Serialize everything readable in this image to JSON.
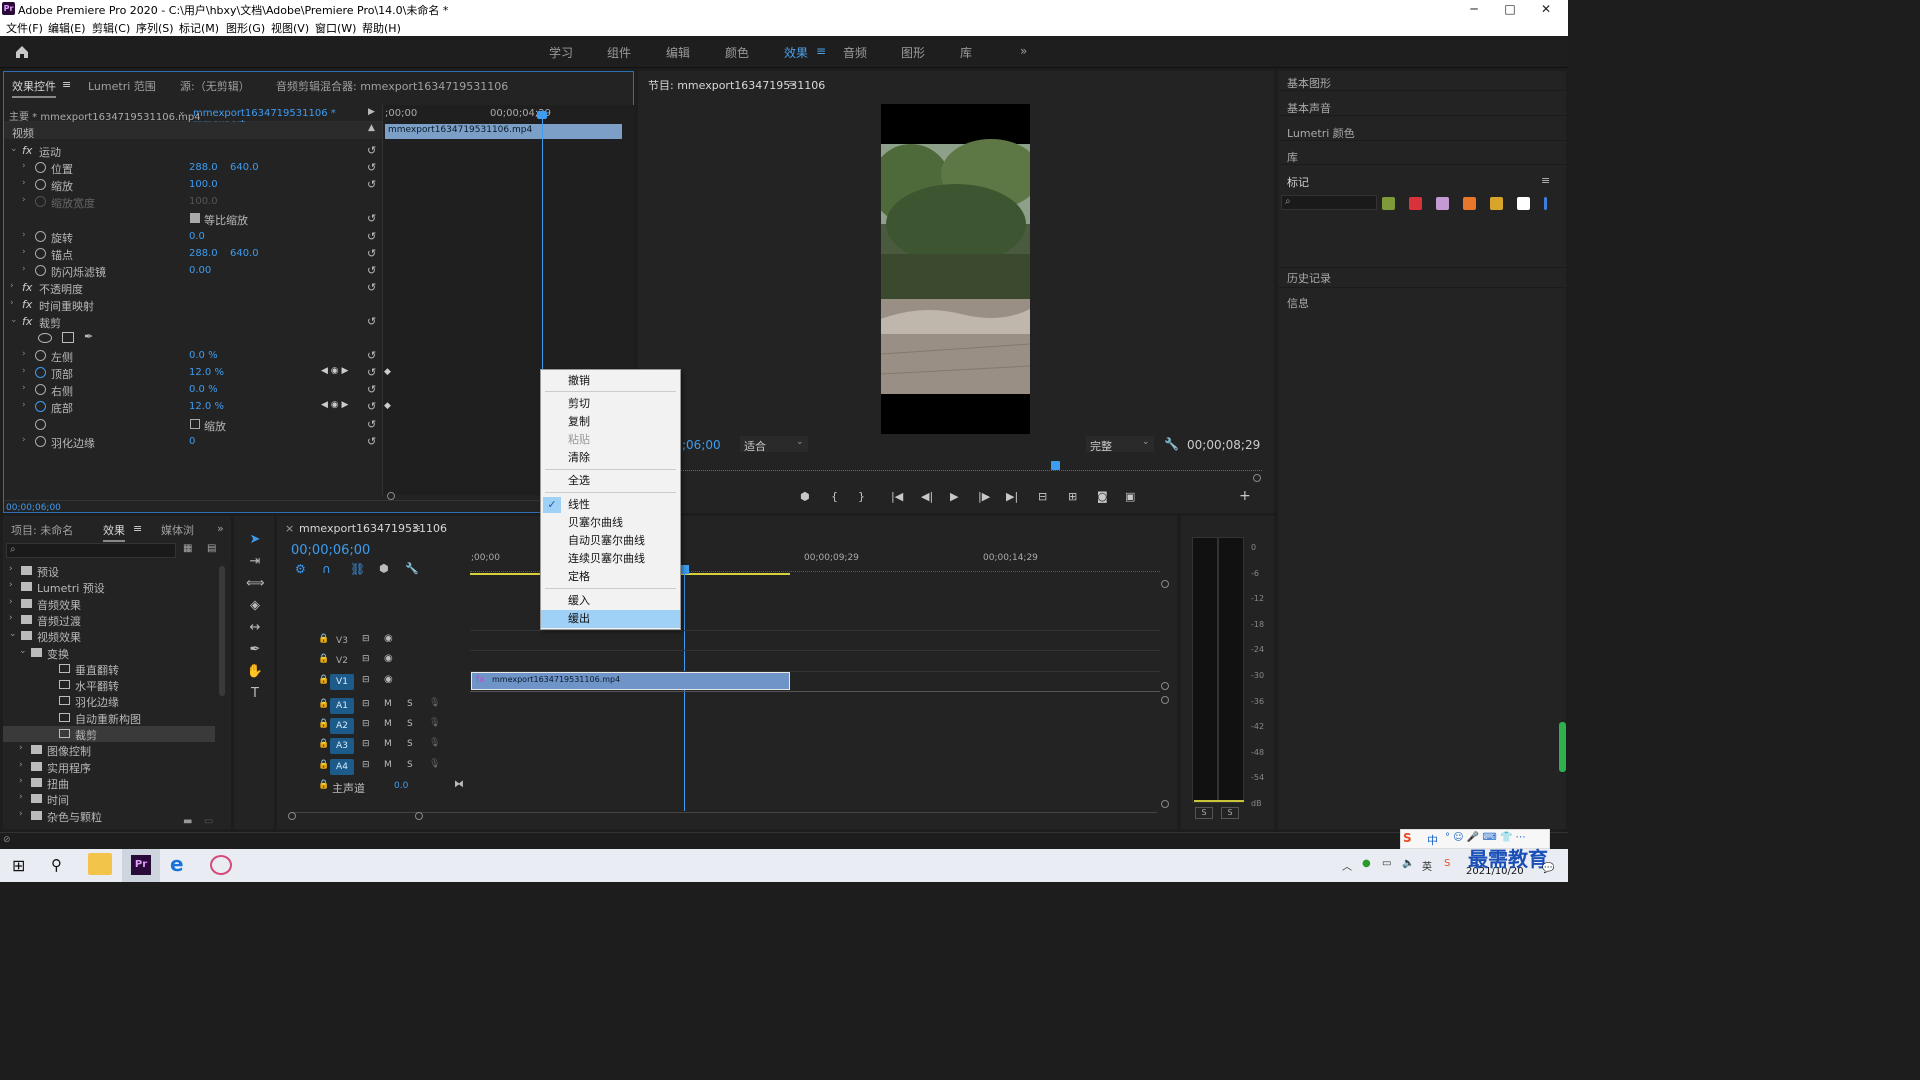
{
  "window": {
    "title": "Adobe Premiere Pro 2020 - C:\\用户\\hbxy\\文档\\Adobe\\Premiere Pro\\14.0\\未命名 *",
    "app_badge": "Pr",
    "controls": [
      "─",
      "□",
      "✕"
    ]
  },
  "menu": [
    "文件(F)",
    "编辑(E)",
    "剪辑(C)",
    "序列(S)",
    "标记(M)",
    "图形(G)",
    "视图(V)",
    "窗口(W)",
    "帮助(H)"
  ],
  "workspaces": [
    "学习",
    "组件",
    "编辑",
    "颜色",
    "效果",
    "音频",
    "图形",
    "库"
  ],
  "active_workspace": "效果",
  "effect_controls": {
    "tabs": [
      "效果控件",
      "Lumetri 范围",
      "源:（无剪辑）",
      "音频剪辑混合器: mmexport1634719531106"
    ],
    "source_label": "主要 * mmexport1634719531106.mp4",
    "sequence_label": "mmexport1634719531106 * mmexport...",
    "time_start": ";00;00",
    "time_mid": "00;00;04;29",
    "clip_name": "mmexport1634719531106.mp4",
    "section_video": "视频",
    "current_time": "00;00;06;00",
    "rows": [
      {
        "label": "运动",
        "fx": true
      },
      {
        "label": "位置",
        "v1": "288.0",
        "v2": "640.0"
      },
      {
        "label": "缩放",
        "v1": "100.0"
      },
      {
        "label": "缩放宽度",
        "v1": "100.0",
        "disabled": true
      },
      {
        "label": "等比缩放",
        "checkbox": true
      },
      {
        "label": "旋转",
        "v1": "0.0"
      },
      {
        "label": "锚点",
        "v1": "288.0",
        "v2": "640.0"
      },
      {
        "label": "防闪烁滤镜",
        "v1": "0.00"
      },
      {
        "label": "不透明度",
        "fx": true
      },
      {
        "label": "时间重映射",
        "fx": true
      },
      {
        "label": "裁剪",
        "fx": true
      },
      {
        "label": "左侧",
        "v1": "0.0 %"
      },
      {
        "label": "顶部",
        "v1": "12.0 %",
        "keyed": true
      },
      {
        "label": "右侧",
        "v1": "0.0 %"
      },
      {
        "label": "底部",
        "v1": "12.0 %",
        "keyed": true
      },
      {
        "label": "缩放",
        "checkbox": true,
        "unchecked": true
      },
      {
        "label": "羽化边缘",
        "v1": "0"
      }
    ]
  },
  "program": {
    "title": "节目: mmexport1634719531106",
    "timecode": ";06;00",
    "fit": "适合",
    "quality": "完整",
    "duration": "00;00;08;29"
  },
  "context_menu": {
    "items": [
      {
        "label": "撤销"
      },
      {
        "label": "剪切"
      },
      {
        "label": "复制"
      },
      {
        "label": "粘贴",
        "disabled": true
      },
      {
        "label": "清除"
      },
      {
        "label": "全选"
      },
      {
        "label": "线性",
        "checked": true
      },
      {
        "label": "贝塞尔曲线"
      },
      {
        "label": "自动贝塞尔曲线"
      },
      {
        "label": "连续贝塞尔曲线"
      },
      {
        "label": "定格"
      },
      {
        "label": "缓入"
      },
      {
        "label": "缓出",
        "highlighted": true
      }
    ]
  },
  "right_panels": {
    "items": [
      "基本图形",
      "基本声音",
      "Lumetri 颜色",
      "库",
      "标记",
      "历史记录",
      "信息"
    ],
    "marker_colors": [
      "#7f9a3a",
      "#d9323a",
      "#c49ad3",
      "#e8772c",
      "#d8a52c",
      "#ffffff",
      "#3c7ee0"
    ]
  },
  "project": {
    "tabs": [
      "项目: 未命名",
      "效果",
      "媒体浏"
    ],
    "tree": [
      {
        "label": "预设",
        "level": 0,
        "type": "folder"
      },
      {
        "label": "Lumetri 预设",
        "level": 0,
        "type": "folder"
      },
      {
        "label": "音频效果",
        "level": 0,
        "type": "folder"
      },
      {
        "label": "音频过渡",
        "level": 0,
        "type": "folder"
      },
      {
        "label": "视频效果",
        "level": 0,
        "type": "folder",
        "open": true
      },
      {
        "label": "变换",
        "level": 1,
        "type": "folder",
        "open": true
      },
      {
        "label": "垂直翻转",
        "level": 2,
        "type": "fx"
      },
      {
        "label": "水平翻转",
        "level": 2,
        "type": "fx"
      },
      {
        "label": "羽化边缘",
        "level": 2,
        "type": "fx"
      },
      {
        "label": "自动重新构图",
        "level": 2,
        "type": "fx"
      },
      {
        "label": "裁剪",
        "level": 2,
        "type": "fx",
        "selected": true
      },
      {
        "label": "图像控制",
        "level": 1,
        "type": "folder"
      },
      {
        "label": "实用程序",
        "level": 1,
        "type": "folder"
      },
      {
        "label": "扭曲",
        "level": 1,
        "type": "folder"
      },
      {
        "label": "时间",
        "level": 1,
        "type": "folder"
      },
      {
        "label": "杂色与颗粒",
        "level": 1,
        "type": "folder"
      }
    ]
  },
  "timeline": {
    "title": "mmexport1634719531106",
    "timecode": "00;00;06;00",
    "ruler": [
      ";00;00",
      "00;00;09;29",
      "00;00;14;29"
    ],
    "video_tracks": [
      "V3",
      "V2",
      "V1"
    ],
    "audio_tracks": [
      "A1",
      "A2",
      "A3",
      "A4"
    ],
    "master_label": "主声道",
    "master_value": "0.0",
    "clip_name": "mmexport1634719531106.mp4",
    "mute_label": "M",
    "solo_label": "S"
  },
  "meter": {
    "ticks": [
      "0",
      "-6",
      "-12",
      "-18",
      "-24",
      "-30",
      "-36",
      "-42",
      "-48",
      "-54",
      "dB"
    ],
    "solo_buttons": [
      "S",
      "S"
    ]
  },
  "taskbar": {
    "ime": "中",
    "time": "2021/10/20",
    "watermark": "最需教育"
  }
}
